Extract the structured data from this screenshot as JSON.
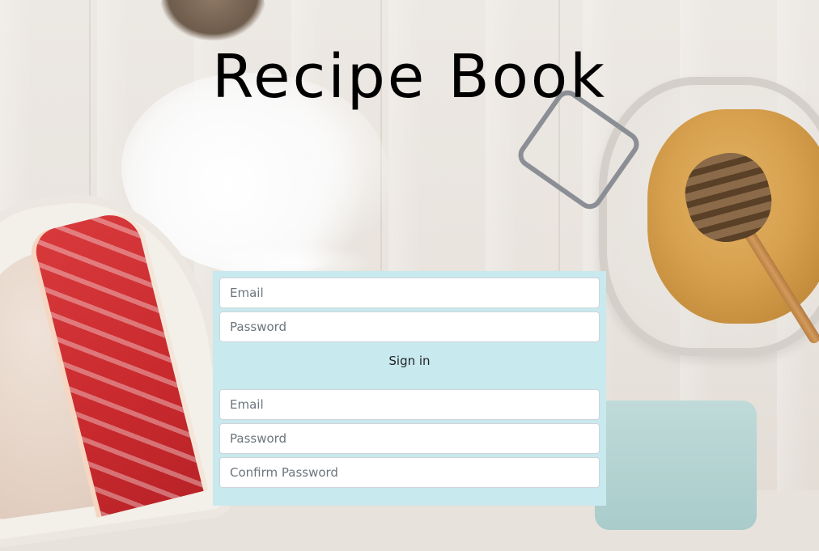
{
  "page": {
    "title": "Recipe Book"
  },
  "sign_in": {
    "email_placeholder": "Email",
    "password_placeholder": "Password",
    "submit_label": "Sign in"
  },
  "sign_up": {
    "email_placeholder": "Email",
    "password_placeholder": "Password",
    "confirm_password_placeholder": "Confirm Password"
  },
  "colors": {
    "panel_background": "#c8e9ee",
    "title_color": "#000000"
  }
}
